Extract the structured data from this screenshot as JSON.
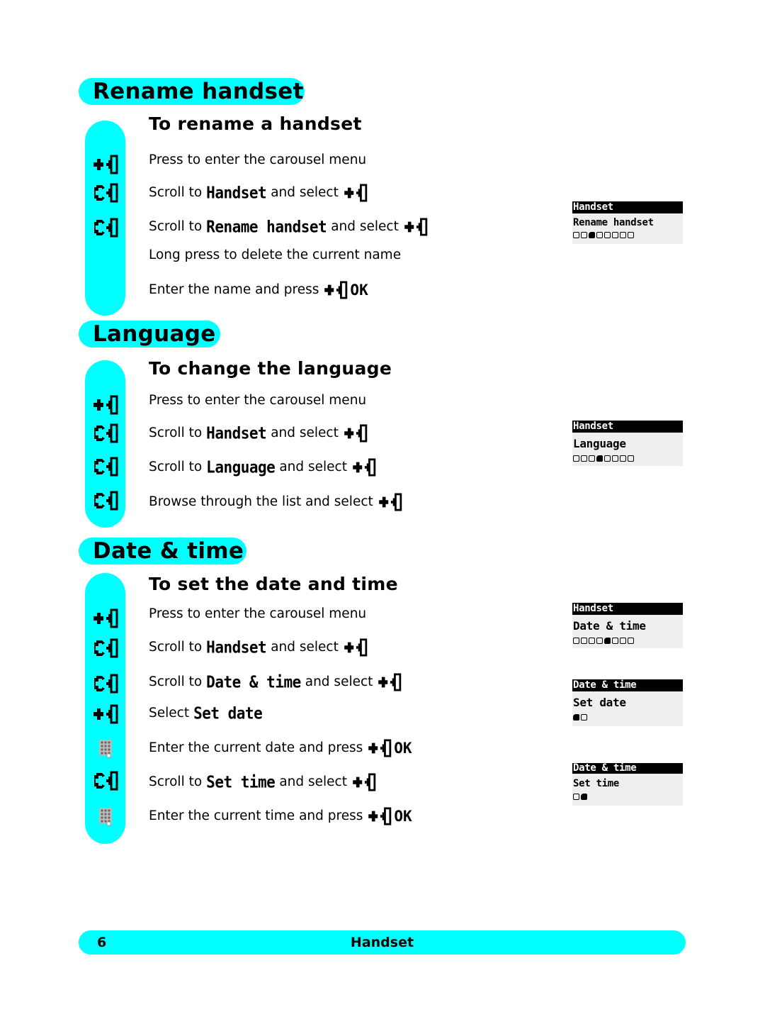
{
  "sections": [
    {
      "title": "Rename handset",
      "subtitle": "To rename a handset",
      "steps": [
        {
          "icon": "select-key-icon",
          "pre": "Press to enter the carousel menu"
        },
        {
          "icon": "scroll-key-icon",
          "pre": "Scroll to",
          "lcd": "Handset",
          "post": "and select",
          "end_icon": "select-key-icon"
        },
        {
          "icon": "scroll-key-icon",
          "pre": "Scroll to",
          "lcd": "Rename handset",
          "post": "and select",
          "end_icon": "select-key-icon"
        },
        {
          "pre": "Long press to delete the current name"
        },
        {
          "pre": "Enter the name and press",
          "end_icon": "select-key-icon",
          "ok": "OK"
        }
      ],
      "displays": [
        {
          "title": "Handset",
          "item": "Rename handset",
          "dots_total": 8,
          "dot_active": 3
        }
      ]
    },
    {
      "title": "Language",
      "subtitle": "To change the language",
      "steps": [
        {
          "icon": "select-key-icon",
          "pre": "Press to enter the carousel menu"
        },
        {
          "icon": "scroll-key-icon",
          "pre": "Scroll to",
          "lcd": "Handset",
          "post": "and select",
          "end_icon": "select-key-icon"
        },
        {
          "icon": "scroll-key-icon",
          "pre": "Scroll to",
          "lcd": "Language",
          "post": "and select",
          "end_icon": "select-key-icon"
        },
        {
          "icon": "scroll-key-icon",
          "pre": "Browse through the list and select",
          "end_icon": "select-key-icon"
        }
      ],
      "displays": [
        {
          "title": "Handset",
          "item": "Language",
          "dots_total": 8,
          "dot_active": 4
        }
      ]
    },
    {
      "title": "Date & time",
      "subtitle": "To set the date and time",
      "steps": [
        {
          "icon": "select-key-icon",
          "pre": "Press to enter the carousel menu"
        },
        {
          "icon": "scroll-key-icon",
          "pre": "Scroll to",
          "lcd": "Handset",
          "post": "and select",
          "end_icon": "select-key-icon"
        },
        {
          "icon": "scroll-key-icon",
          "pre": "Scroll to",
          "lcd": "Date & time",
          "post": "and select",
          "end_icon": "select-key-icon"
        },
        {
          "icon": "select-key-icon",
          "pre": "Select",
          "lcd": "Set date"
        },
        {
          "icon": "keypad-icon",
          "pre": "Enter the current date and press",
          "end_icon": "select-key-icon",
          "ok": "OK"
        },
        {
          "icon": "scroll-key-icon",
          "pre": "Scroll to",
          "lcd": "Set time",
          "post": "and select",
          "end_icon": "select-key-icon"
        },
        {
          "icon": "keypad-icon",
          "pre": "Enter the current time and press",
          "end_icon": "select-key-icon",
          "ok": "OK"
        }
      ],
      "displays": [
        {
          "title": "Handset",
          "item": "Date & time",
          "dots_total": 8,
          "dot_active": 5
        },
        {
          "title": "Date & time",
          "item": "Set date",
          "dots_total": 2,
          "dot_active": 1
        },
        {
          "title": "Date & time",
          "item": "Set time",
          "dots_total": 2,
          "dot_active": 2
        }
      ]
    }
  ],
  "footer": {
    "page_number": "6",
    "title": "Handset"
  },
  "colors": {
    "accent": "#00ffff",
    "lcd_background": "#efefef",
    "lcd_title_bar": "#000000"
  }
}
